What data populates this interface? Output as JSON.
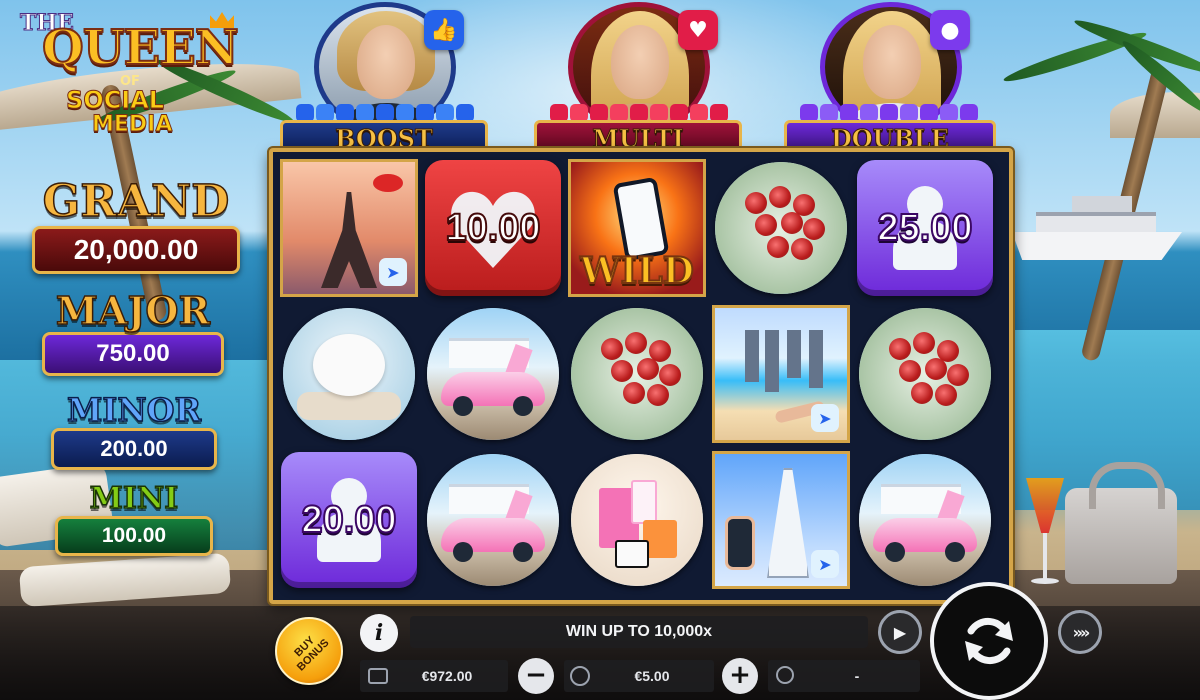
{
  "game": {
    "logo": {
      "line1": "THE",
      "line2": "QUEEN",
      "line3": "OF",
      "line4": "SOCIAL",
      "line5": "MEDIA"
    }
  },
  "jackpots": [
    {
      "name": "GRAND",
      "amount": "20,000.00"
    },
    {
      "name": "MAJOR",
      "amount": "750.00"
    },
    {
      "name": "MINOR",
      "amount": "200.00"
    },
    {
      "name": "MINI",
      "amount": "100.00"
    }
  ],
  "influencers": [
    {
      "label": "BOOST",
      "badge_icon": "thumbs-up-icon"
    },
    {
      "label": "MULTI",
      "badge_icon": "heart-icon"
    },
    {
      "label": "DOUBLE",
      "badge_icon": "user-icon"
    }
  ],
  "reels": {
    "grid": [
      [
        "eiffel-tower",
        "dog",
        "value-purple"
      ],
      [
        "value-red",
        "pink-car",
        "pink-car"
      ],
      [
        "wild-phone",
        "roses",
        "shopping-bags"
      ],
      [
        "roses",
        "beach",
        "dubai"
      ],
      [
        "value-purple",
        "roses",
        "pink-car"
      ]
    ],
    "values": {
      "r0c1": "10.00",
      "r0c4": "25.00",
      "r2c0": "20.00"
    },
    "wild_label": "WILD"
  },
  "controls": {
    "buy_bonus": "BUY BONUS",
    "info": "i",
    "win_banner": "WIN UP TO 10,000x",
    "balance": "€972.00",
    "bet": "€5.00",
    "win": "-",
    "minus": "−",
    "plus": "+"
  },
  "colors": {
    "gold": "#d4a548",
    "grand": "#8b1a1a",
    "major": "#6d28d9",
    "minor": "#1e3a8a",
    "mini": "#15803d"
  }
}
